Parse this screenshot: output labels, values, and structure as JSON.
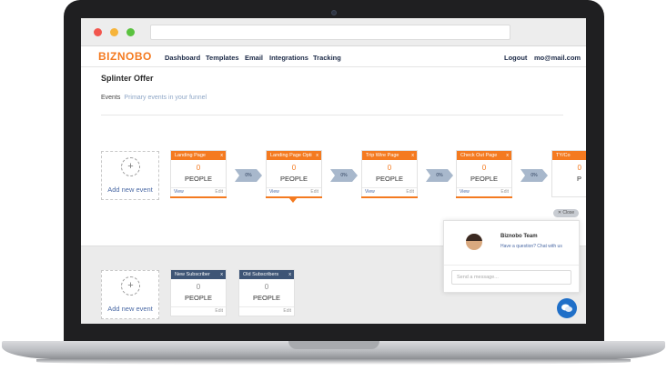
{
  "app": {
    "logo": "BIZNOBO"
  },
  "nav": {
    "links": [
      "Dashboard",
      "Templates",
      "Email",
      "Integrations",
      "Tracking"
    ],
    "logout": "Logout",
    "user_email": "mo@mail.com"
  },
  "page": {
    "title": "Splinter Offer",
    "subnav_label": "Events",
    "subnav_hint": "Primary events in your funnel"
  },
  "funnel": {
    "add_label": "Add new event",
    "arrow_value": "0%",
    "cards": [
      {
        "title": "Landing Page",
        "count": "0",
        "unit": "PEOPLE",
        "view": "View",
        "edit": "Edit"
      },
      {
        "title": "Landing Page Opti",
        "count": "0",
        "unit": "PEOPLE",
        "view": "View",
        "edit": "Edit"
      },
      {
        "title": "Trip Wire Page",
        "count": "0",
        "unit": "PEOPLE",
        "view": "View",
        "edit": "Edit"
      },
      {
        "title": "Check Out Page",
        "count": "0",
        "unit": "PEOPLE",
        "view": "View",
        "edit": "Edit"
      },
      {
        "title": "TY/Co",
        "count": "0",
        "unit": "P",
        "view": "",
        "edit": ""
      }
    ],
    "close_x": "x"
  },
  "secondary": {
    "add_label": "Add new event",
    "cards": [
      {
        "title": "New Subscriber",
        "count": "0",
        "unit": "PEOPLE",
        "edit": "Edit"
      },
      {
        "title": "Old Subscribers",
        "count": "0",
        "unit": "PEOPLE",
        "edit": "Edit"
      }
    ]
  },
  "chat": {
    "close_label": "✕ Close",
    "team_name": "Biznobo Team",
    "prompt": "Have a question? Chat with us",
    "input_placeholder": "Send a message..."
  },
  "colors": {
    "accent": "#f47a20",
    "navy": "#3e5576",
    "chat_blue": "#1f6fc8"
  }
}
